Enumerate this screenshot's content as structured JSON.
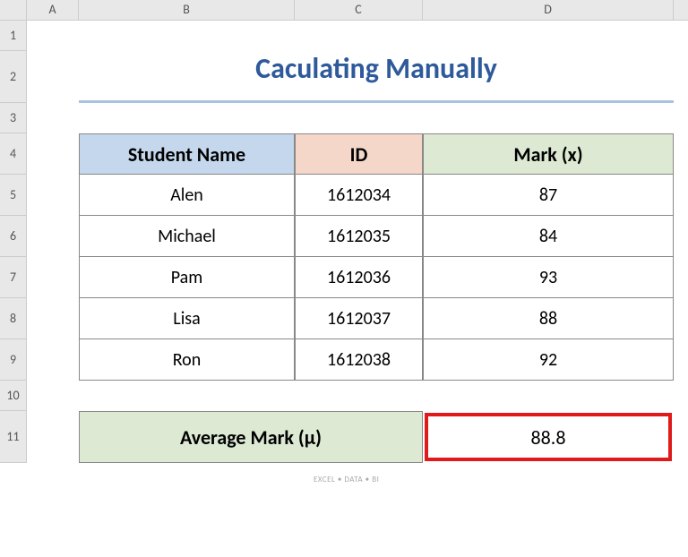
{
  "headers": {
    "cols": {
      "A": "A",
      "B": "B",
      "C": "C",
      "D": "D"
    },
    "rows": {
      "1": "1",
      "2": "2",
      "3": "3",
      "4": "4",
      "5": "5",
      "6": "6",
      "7": "7",
      "8": "8",
      "9": "9",
      "10": "10",
      "11": "11"
    }
  },
  "title": "Caculating Manually",
  "table": {
    "headers": {
      "name": "Student Name",
      "id": "ID",
      "mark": "Mark (x)"
    },
    "rows": [
      {
        "name": "Alen",
        "id": "1612034",
        "mark": "87"
      },
      {
        "name": "Michael",
        "id": "1612035",
        "mark": "84"
      },
      {
        "name": "Pam",
        "id": "1612036",
        "mark": "93"
      },
      {
        "name": "Lisa",
        "id": "1612037",
        "mark": "88"
      },
      {
        "name": "Ron",
        "id": "1612038",
        "mark": "92"
      }
    ]
  },
  "summary": {
    "label": "Average Mark (μ)",
    "value": "88.8"
  },
  "watermark": "EXCEL • DATA • BI",
  "chart_data": {
    "type": "table",
    "title": "Caculating Manually",
    "columns": [
      "Student Name",
      "ID",
      "Mark (x)"
    ],
    "rows": [
      [
        "Alen",
        1612034,
        87
      ],
      [
        "Michael",
        1612035,
        84
      ],
      [
        "Pam",
        1612036,
        93
      ],
      [
        "Lisa",
        1612037,
        88
      ],
      [
        "Ron",
        1612038,
        92
      ]
    ],
    "summary": {
      "label": "Average Mark (μ)",
      "value": 88.8
    }
  }
}
